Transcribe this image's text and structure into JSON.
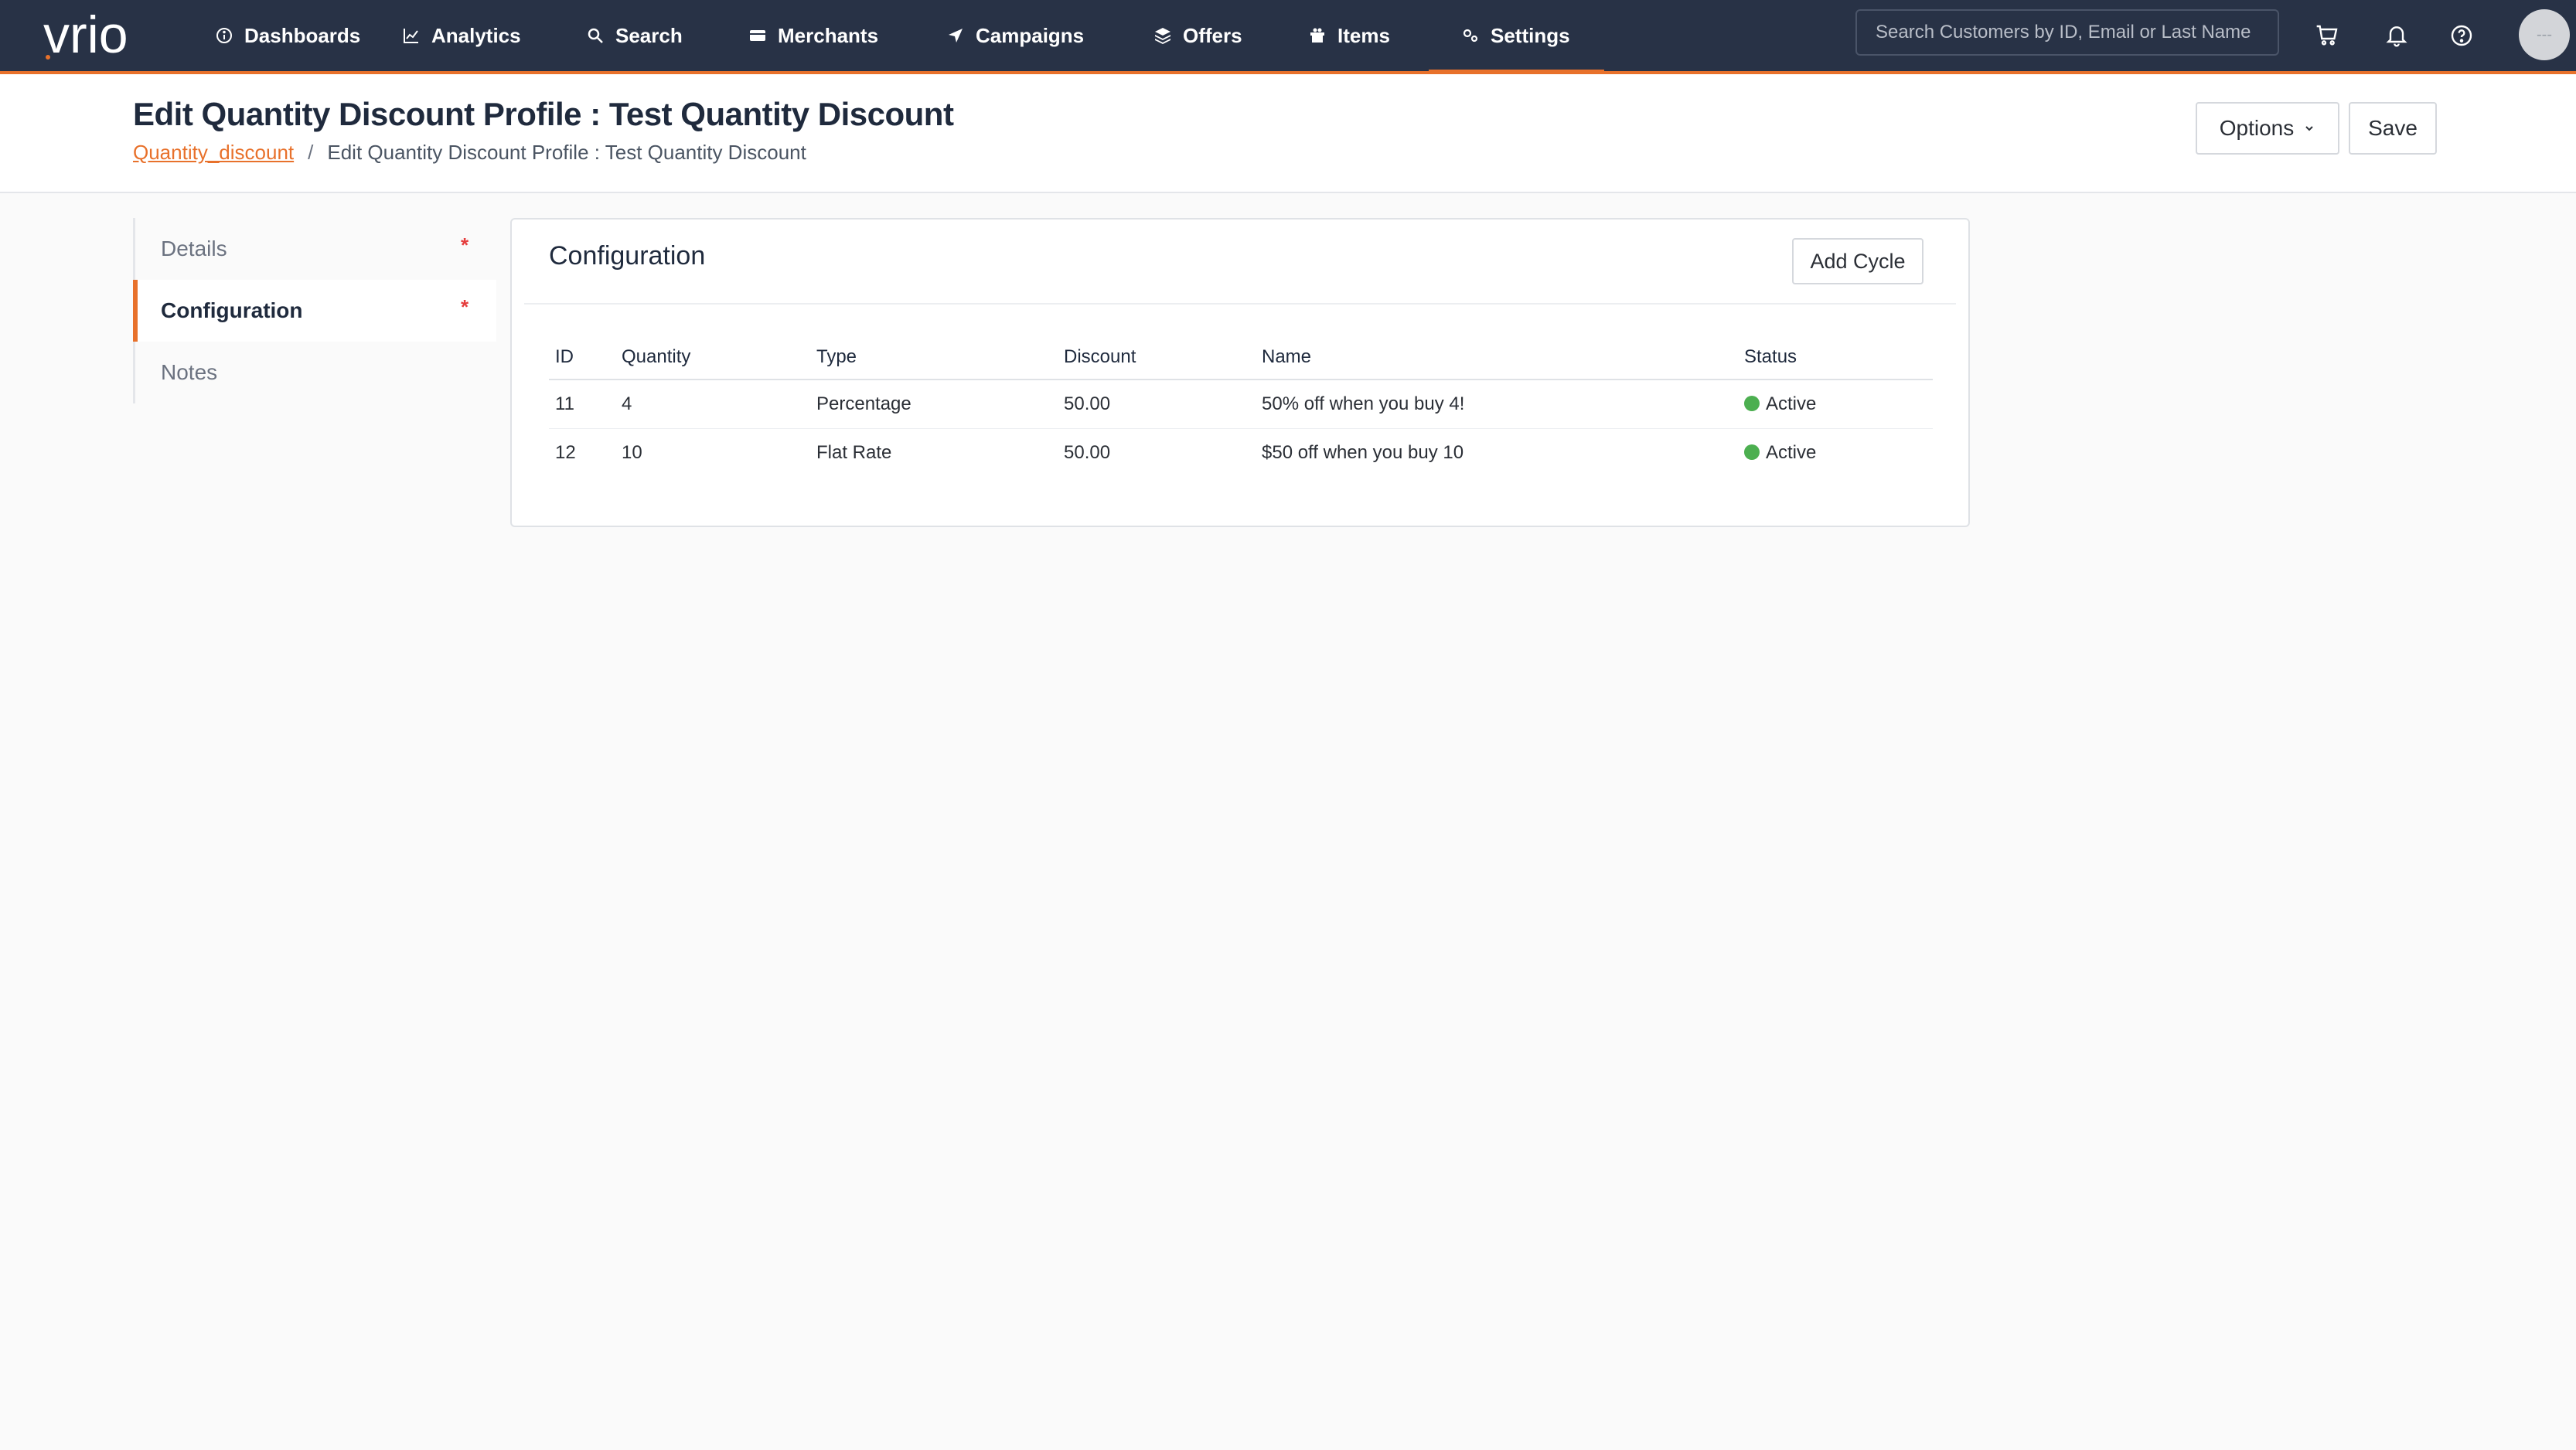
{
  "app": {
    "logo_text": "vrio"
  },
  "nav": {
    "items": [
      {
        "label": "Dashboards"
      },
      {
        "label": "Analytics"
      },
      {
        "label": "Search"
      },
      {
        "label": "Merchants"
      },
      {
        "label": "Campaigns"
      },
      {
        "label": "Offers"
      },
      {
        "label": "Items"
      },
      {
        "label": "Settings",
        "active": true
      }
    ],
    "search_placeholder": "Search Customers by ID, Email or Last Name",
    "avatar_text": "---"
  },
  "header": {
    "title": "Edit Quantity Discount Profile : Test Quantity Discount",
    "breadcrumb": {
      "link": "Quantity_discount",
      "separator": "/",
      "current": "Edit Quantity Discount Profile : Test Quantity Discount"
    },
    "options_label": "Options",
    "save_label": "Save"
  },
  "sidebar": {
    "items": [
      {
        "label": "Details",
        "required": "*"
      },
      {
        "label": "Configuration",
        "required": "*",
        "active": true
      },
      {
        "label": "Notes"
      }
    ]
  },
  "configuration": {
    "title": "Configuration",
    "add_cycle_label": "Add Cycle",
    "columns": [
      "ID",
      "Quantity",
      "Type",
      "Discount",
      "Name",
      "Status"
    ],
    "rows": [
      {
        "id": "11",
        "quantity": "4",
        "type": "Percentage",
        "discount": "50.00",
        "name": "50% off when you buy 4!",
        "status": "Active"
      },
      {
        "id": "12",
        "quantity": "10",
        "type": "Flat Rate",
        "discount": "50.00",
        "name": "$50 off when you buy 10",
        "status": "Active"
      }
    ]
  },
  "colors": {
    "nav_bg": "#283246",
    "accent": "#e8712b",
    "status_active": "#4caf50",
    "required": "#e53e3e"
  }
}
